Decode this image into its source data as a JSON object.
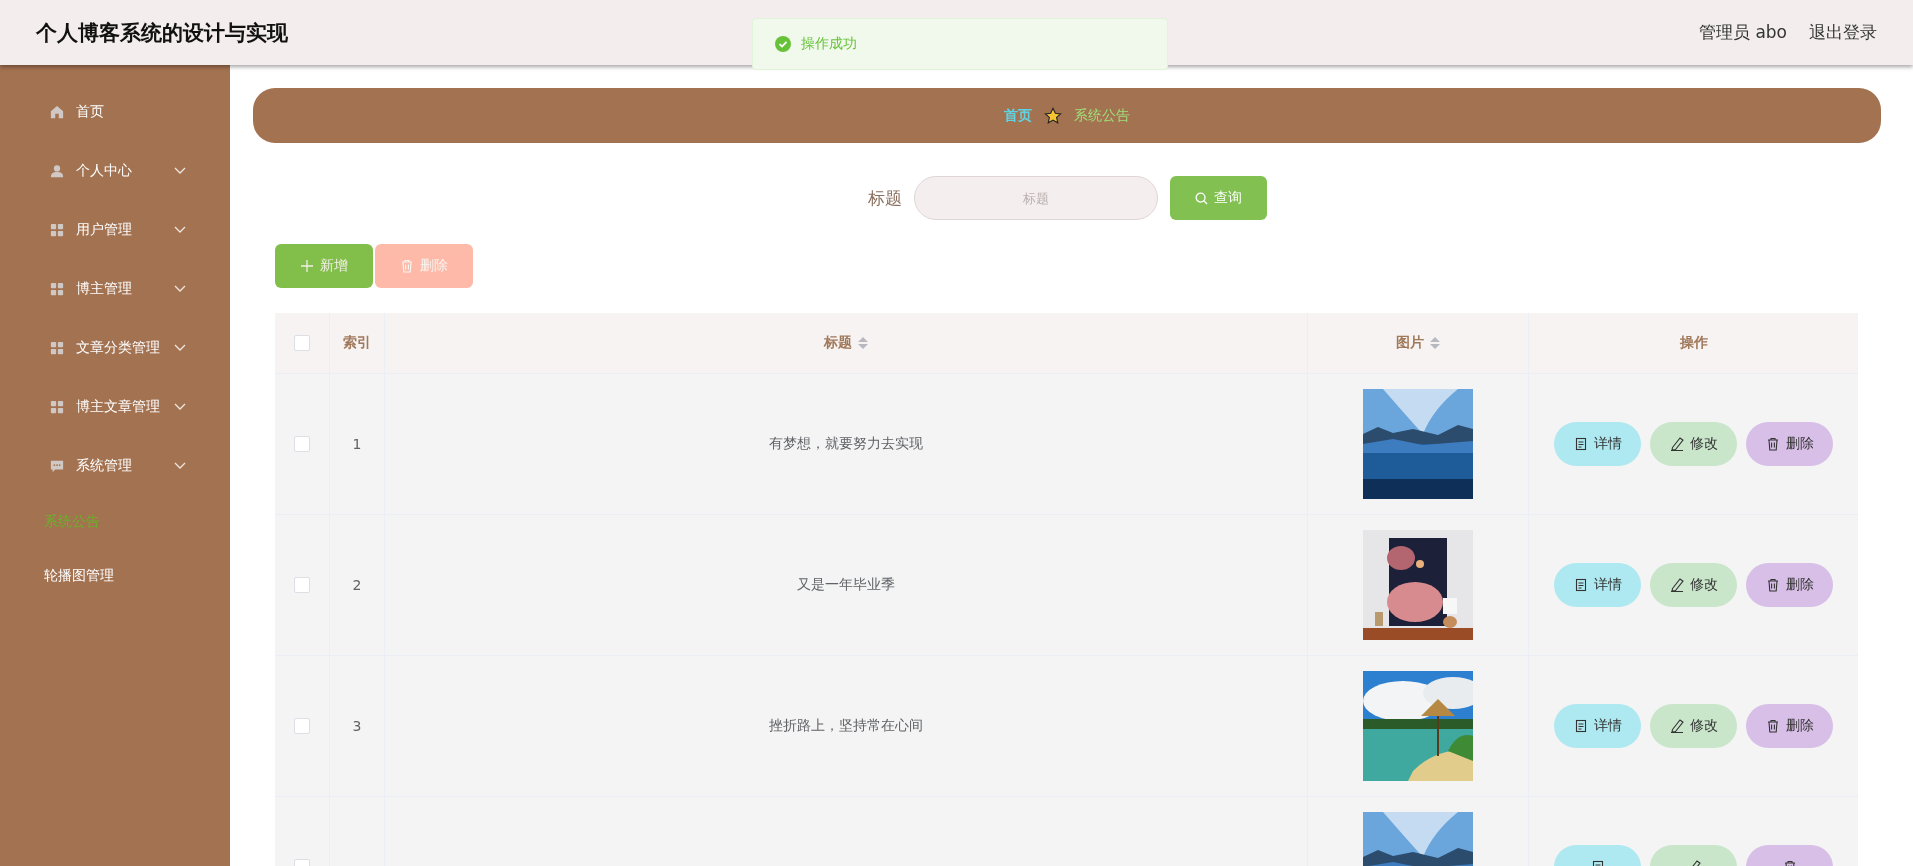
{
  "header": {
    "title": "个人博客系统的设计与实现",
    "user_label": "管理员 abo",
    "logout": "退出登录"
  },
  "toast": {
    "message": "操作成功"
  },
  "sidebar": {
    "items": [
      {
        "label": "首页",
        "kind": "home",
        "selected": false
      },
      {
        "label": "个人中心",
        "kind": "user",
        "selected": false
      },
      {
        "label": "用户管理",
        "kind": "grid",
        "selected": false
      },
      {
        "label": "博主管理",
        "kind": "grid",
        "selected": false
      },
      {
        "label": "文章分类管理",
        "kind": "grid",
        "selected": false
      },
      {
        "label": "博主文章管理",
        "kind": "grid",
        "selected": false
      },
      {
        "label": "系统管理",
        "kind": "chat",
        "selected": false,
        "children": [
          {
            "label": "系统公告",
            "selected": true
          },
          {
            "label": "轮播图管理",
            "selected": false
          }
        ]
      }
    ]
  },
  "breadcrumb": [
    {
      "label": "首页",
      "kind": "link"
    },
    {
      "label": "系统公告",
      "kind": "current"
    }
  ],
  "search": {
    "label": "标题",
    "placeholder": "标题",
    "button": "查询"
  },
  "toolbar": [
    {
      "label": "新增",
      "kind": "add",
      "disabled": false
    },
    {
      "label": "删除",
      "kind": "delete",
      "disabled": true
    }
  ],
  "table": {
    "all_checked": false,
    "columns": [
      {
        "label": "索引",
        "sortable": false
      },
      {
        "label": "标题",
        "sortable": true
      },
      {
        "label": "图片",
        "sortable": true
      },
      {
        "label": "操作",
        "sortable": false
      }
    ],
    "rows": [
      {
        "index": "1",
        "title": "有梦想，就要努力去实现",
        "image": {
          "kind": "picture"
        },
        "checked": false,
        "actions": [
          {
            "label": "详情",
            "kind": "detail"
          },
          {
            "label": "修改",
            "kind": "edit"
          },
          {
            "label": "删除",
            "kind": "delete"
          }
        ]
      },
      {
        "index": "2",
        "title": "又是一年毕业季",
        "image": {
          "kind": "picture"
        },
        "checked": false,
        "actions": [
          {
            "label": "详情",
            "kind": "detail"
          },
          {
            "label": "修改",
            "kind": "edit"
          },
          {
            "label": "删除",
            "kind": "delete"
          }
        ]
      },
      {
        "index": "3",
        "title": "挫折路上，坚持常在心间",
        "image": {
          "kind": "picture"
        },
        "checked": false,
        "actions": [
          {
            "label": "详情",
            "kind": "detail"
          },
          {
            "label": "修改",
            "kind": "edit"
          },
          {
            "label": "删除",
            "kind": "delete"
          }
        ]
      },
      {
        "image": {
          "kind": "picture"
        },
        "checked": false,
        "actions": [
          {
            "kind": "detail"
          },
          {
            "kind": "edit"
          },
          {
            "kind": "delete"
          }
        ]
      }
    ]
  }
}
